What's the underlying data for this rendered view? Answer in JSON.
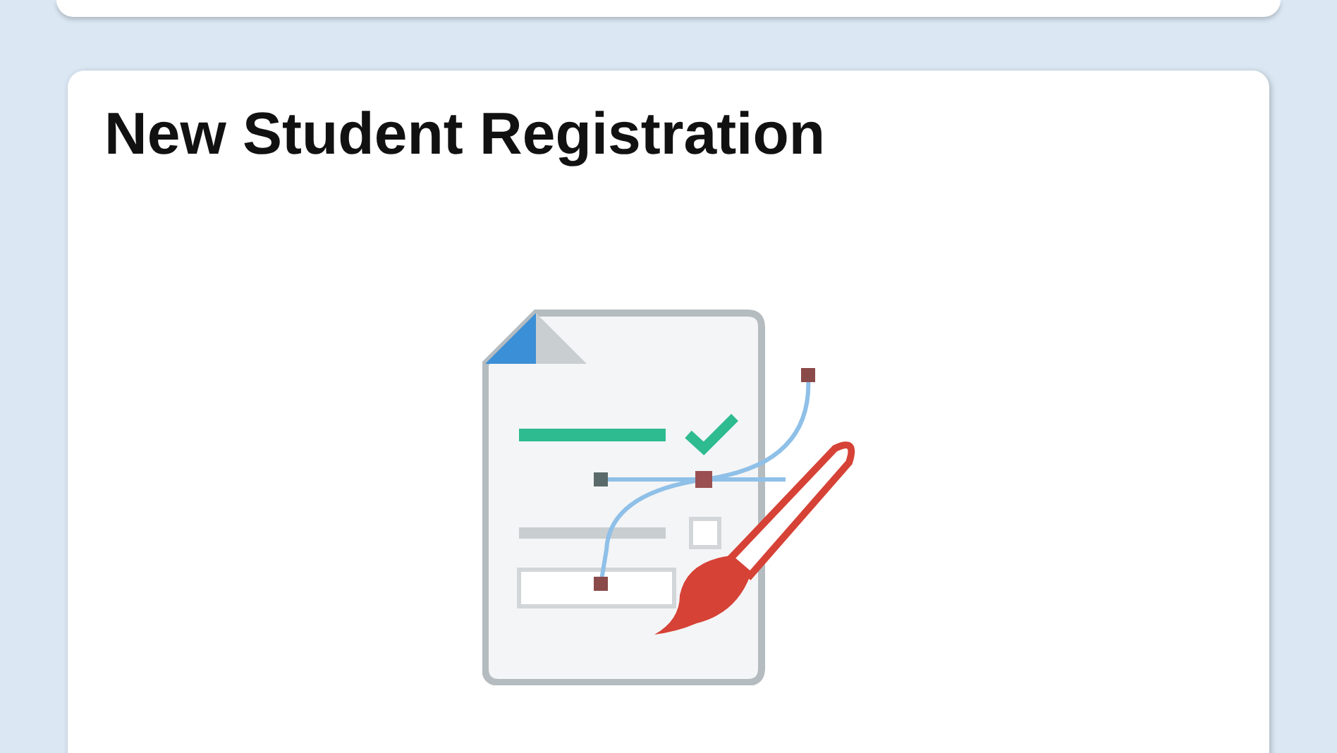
{
  "tile": {
    "title": "New Student Registration"
  }
}
